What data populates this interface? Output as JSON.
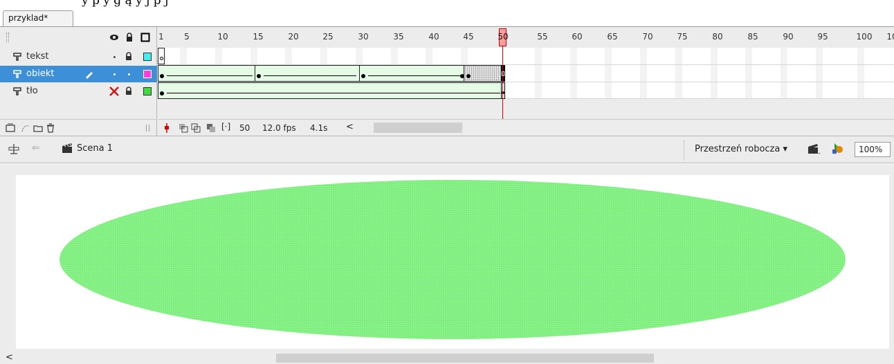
{
  "cropped_text": "y    p        y g ą y   j         p     j",
  "document": {
    "tab_label": "przyklad*"
  },
  "timeline": {
    "ruler_labels": [
      "1",
      "5",
      "10",
      "15",
      "20",
      "25",
      "30",
      "35",
      "40",
      "45",
      "50",
      "55",
      "60",
      "65",
      "70",
      "75",
      "80",
      "85",
      "90",
      "95",
      "100",
      "10"
    ],
    "current_frame_marker": "50",
    "layers": [
      {
        "name": "tekst",
        "color": "#3ff0f0",
        "selected": false
      },
      {
        "name": "obiekt",
        "color": "#ff3fd6",
        "selected": true
      },
      {
        "name": "tło",
        "color": "#3fdb3f",
        "selected": false
      }
    ],
    "status": {
      "current_frame": "50",
      "fps": "12.0 fps",
      "elapsed": "4.1s",
      "scroll_left": "<"
    }
  },
  "editbar": {
    "scene_label": "Scena 1",
    "workspace_label": "Przestrzeń robocza ▾",
    "zoom": "100%"
  },
  "stage": {
    "shape_color": "#7ff07f",
    "scroll_left": "<"
  }
}
